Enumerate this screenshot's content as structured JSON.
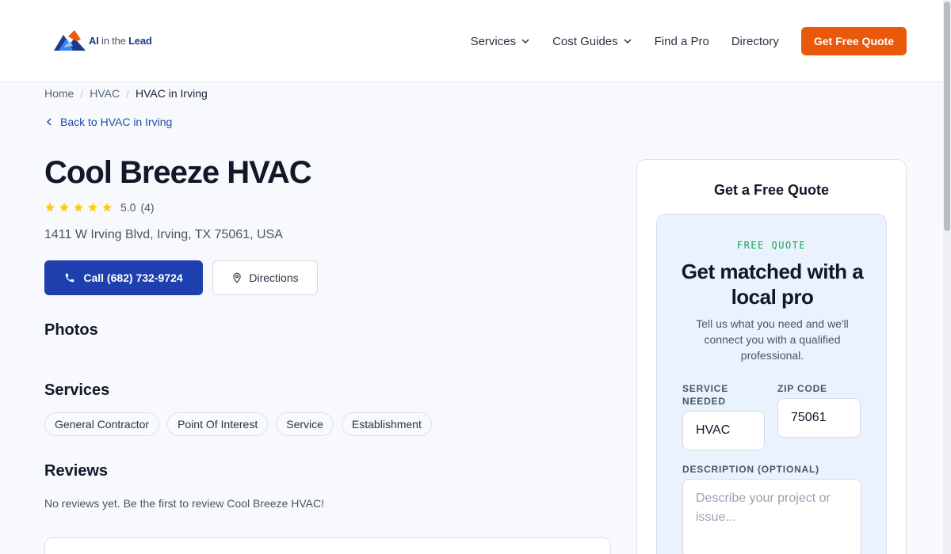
{
  "brand": {
    "name_bold_prefix": "AI",
    "name_light": "in the",
    "name_bold_suffix": "Lead",
    "accent": "#ea580c",
    "primary": "#1e40af"
  },
  "nav": {
    "items": [
      {
        "label": "Services",
        "has_dropdown": true
      },
      {
        "label": "Cost Guides",
        "has_dropdown": true
      },
      {
        "label": "Find a Pro",
        "has_dropdown": false
      },
      {
        "label": "Directory",
        "has_dropdown": false
      }
    ],
    "cta_label": "Get Free Quote"
  },
  "breadcrumb": {
    "items": [
      "Home",
      "HVAC",
      "HVAC in Irving"
    ]
  },
  "back_link": "Back to HVAC in Irving",
  "business": {
    "name": "Cool Breeze HVAC",
    "rating_value": "5.0",
    "review_count": "(4)",
    "stars": 5,
    "address": "1411 W Irving Blvd, Irving, TX 75061, USA",
    "call_label": "Call (682) 732-9724",
    "directions_label": "Directions"
  },
  "sections": {
    "photos": "Photos",
    "services": "Services",
    "reviews": "Reviews"
  },
  "services": [
    "General Contractor",
    "Point Of Interest",
    "Service",
    "Establishment"
  ],
  "reviews_empty": "No reviews yet. Be the first to review Cool Breeze HVAC!",
  "sidebar": {
    "title": "Get a Free Quote",
    "eyebrow": "FREE QUOTE",
    "heading": "Get matched with a local pro",
    "subtext": "Tell us what you need and we'll connect you with a qualified professional.",
    "service_label": "SERVICE NEEDED",
    "service_value": "HVAC",
    "zip_label": "ZIP CODE",
    "zip_value": "75061",
    "description_label": "DESCRIPTION (OPTIONAL)",
    "description_placeholder": "Describe your project or issue..."
  }
}
